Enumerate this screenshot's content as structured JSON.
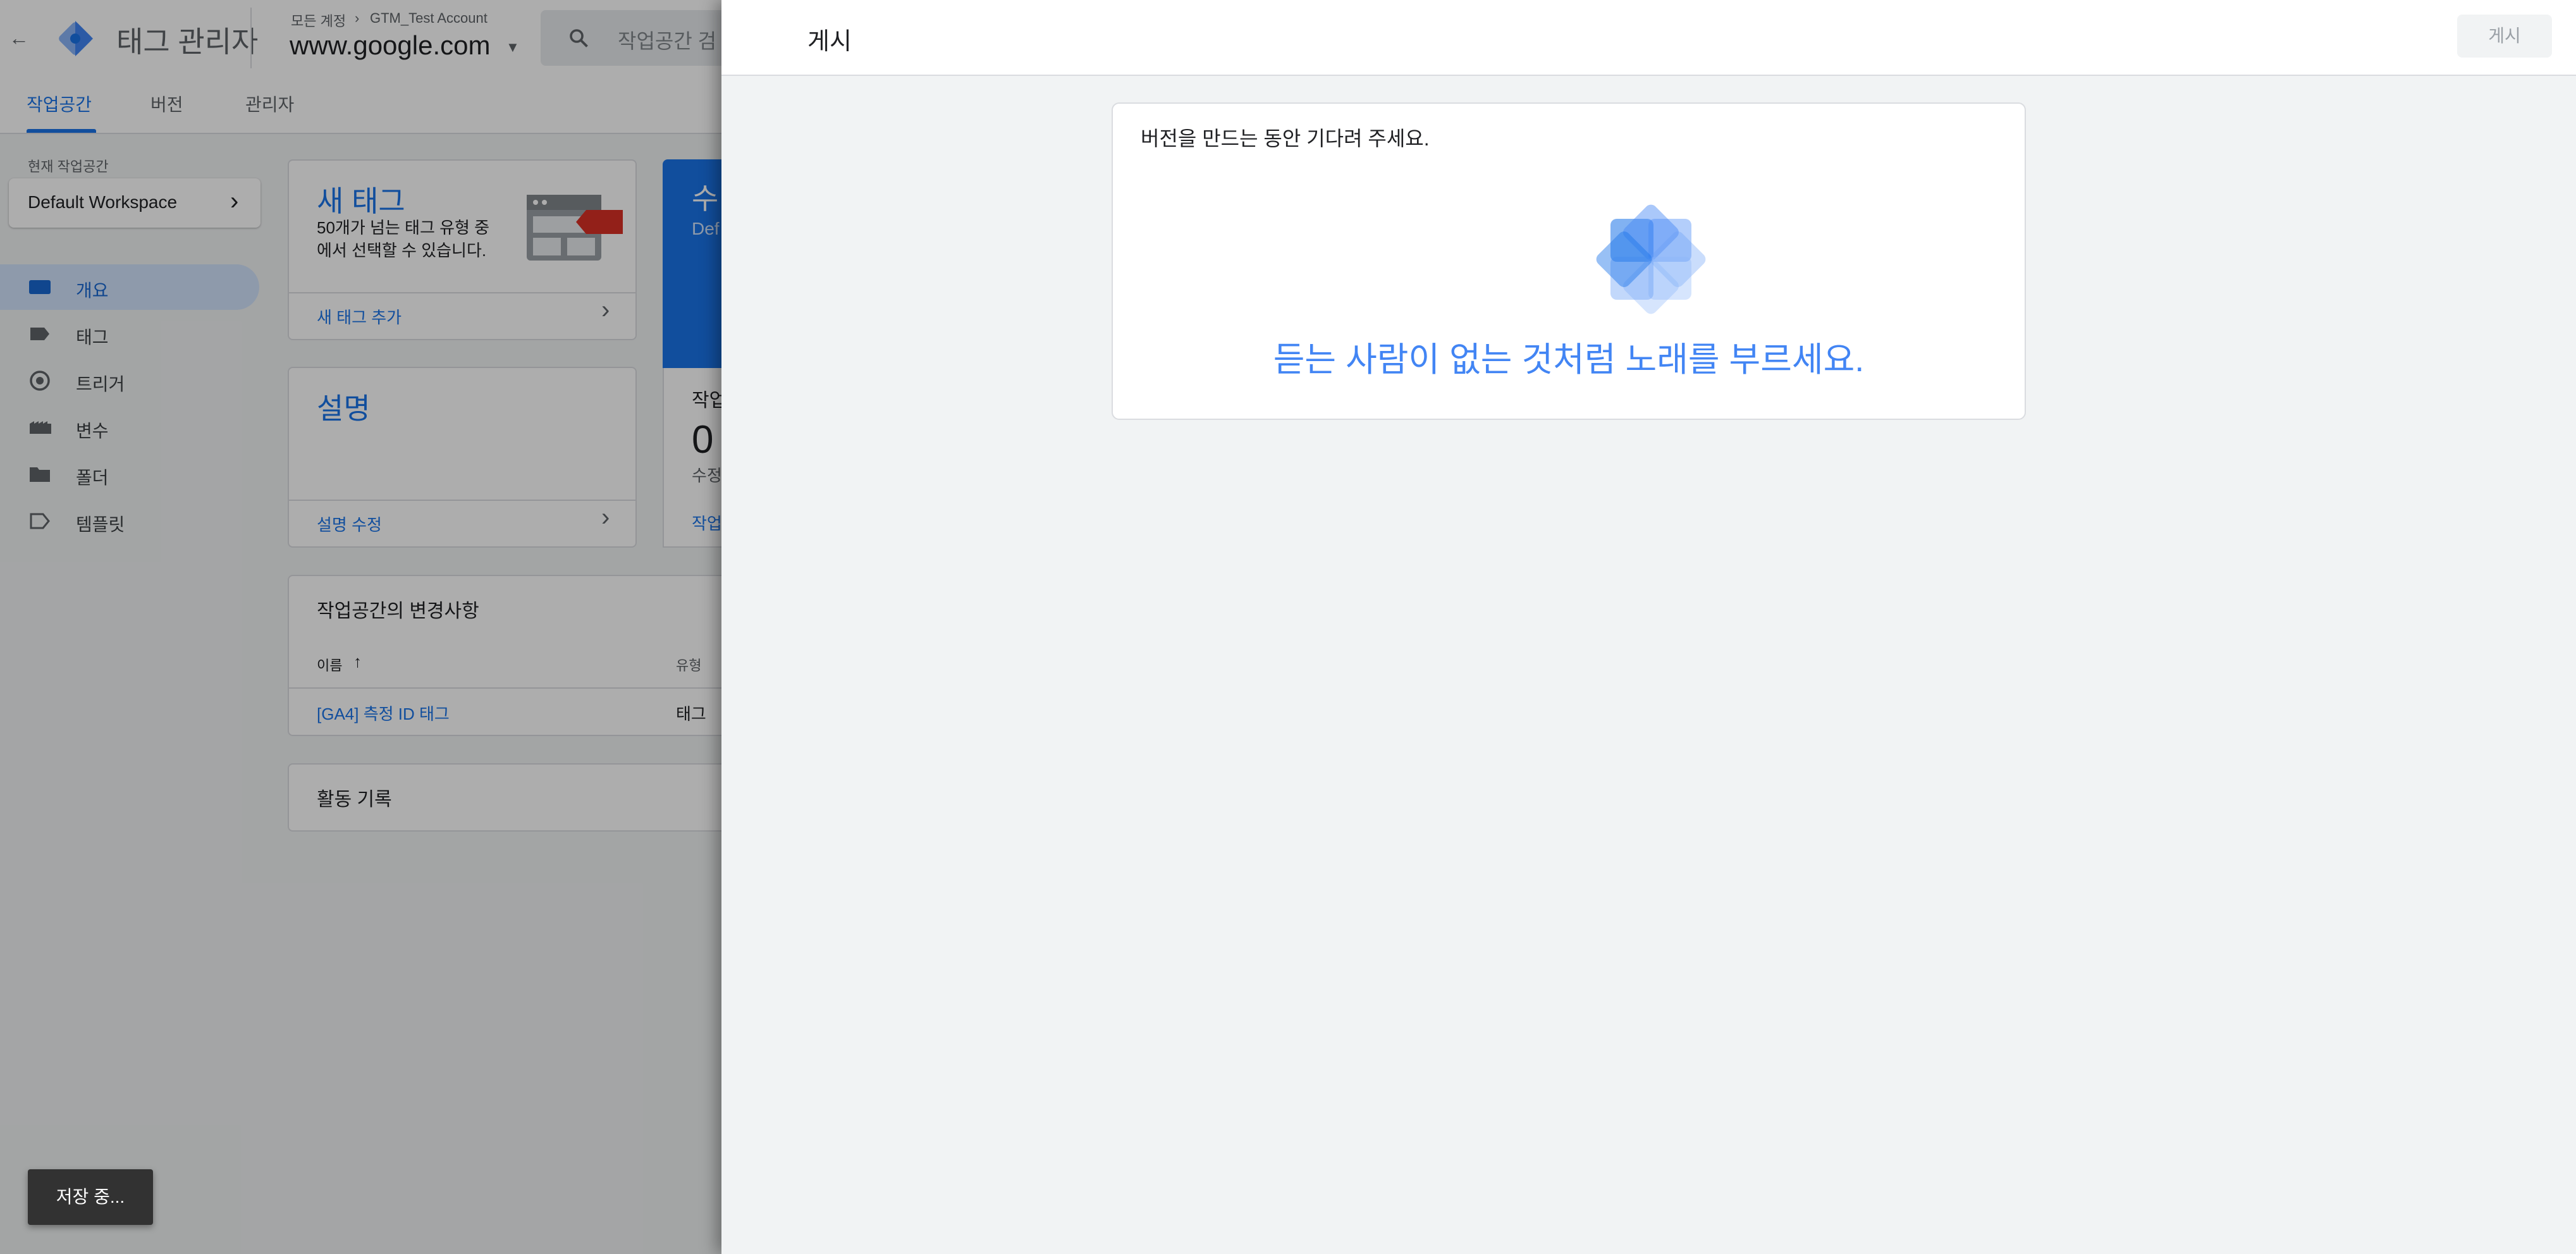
{
  "app": {
    "title": "태그 관리자",
    "breadcrumb_parent": "모든 계정",
    "breadcrumb_account": "GTM_Test Account",
    "container_name": "www.google.com",
    "search_placeholder": "작업공간 검"
  },
  "tabs": [
    {
      "label": "작업공간"
    },
    {
      "label": "버전"
    },
    {
      "label": "관리자"
    }
  ],
  "workspace": {
    "caption": "현재 작업공간",
    "name": "Default Workspace"
  },
  "nav": [
    {
      "label": "개요",
      "icon": "overview-icon"
    },
    {
      "label": "태그",
      "icon": "tag-icon"
    },
    {
      "label": "트리거",
      "icon": "trigger-icon"
    },
    {
      "label": "변수",
      "icon": "variable-icon"
    },
    {
      "label": "폴더",
      "icon": "folder-icon"
    },
    {
      "label": "템플릿",
      "icon": "template-icon"
    }
  ],
  "cards": {
    "new_tag": {
      "title": "새 태그",
      "desc": "50개가 넘는 태그 유형 중에서 선택할 수 있습니다.",
      "link": "새 태그 추가"
    },
    "description": {
      "title": "설명",
      "link": "설명 수정"
    },
    "blue": {
      "title": "수",
      "subtitle": "Def"
    },
    "stats": {
      "label": "작업",
      "value": "0",
      "caption": "수정",
      "link": "작업"
    }
  },
  "changes": {
    "title": "작업공간의 변경사항",
    "columns": [
      "이름",
      "유형"
    ],
    "rows": [
      {
        "name": "[GA4] 측정 ID 태그",
        "type": "태그"
      }
    ]
  },
  "activity": {
    "title": "활동 기록"
  },
  "toast": {
    "text": "저장 중..."
  },
  "panel": {
    "title": "게시",
    "publish_button": "게시",
    "wait_message": "버전을 만드는 동안 기다려 주세요.",
    "tagline": "듣는 사람이 없는 것처럼 노래를 부르세요."
  },
  "colors": {
    "accent": "#1a73e8",
    "tagline": "#4285f4",
    "brand_blue": "#1a73e8",
    "tag_red": "#d93025"
  }
}
